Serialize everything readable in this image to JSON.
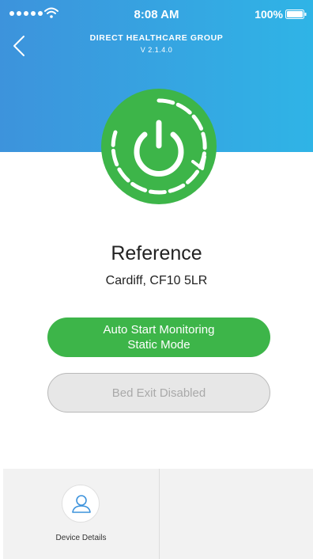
{
  "status_bar": {
    "time": "8:08 AM",
    "battery": "100%",
    "icons": [
      "signal-dots-icon",
      "wifi-icon",
      "battery-icon"
    ]
  },
  "header": {
    "title": "DIRECT HEALTHCARE GROUP",
    "version": "V 2.1.4.0",
    "back_icon": "chevron-left-icon"
  },
  "power": {
    "icon": "power-icon"
  },
  "site": {
    "reference": "Reference",
    "location": "Cardiff, CF10 5LR"
  },
  "buttons": {
    "monitor_line1": "Auto Start Monitoring",
    "monitor_line2": "Static Mode",
    "bed_exit": "Bed Exit Disabled"
  },
  "bottom_nav": {
    "device_details_label": "Device Details",
    "device_details_icon": "user-icon"
  },
  "colors": {
    "header_start": "#3d93dc",
    "header_end": "#2fb4e6",
    "accent_green": "#3db549",
    "disabled_bg": "#e7e7e7",
    "disabled_text": "#a9a9a9"
  }
}
